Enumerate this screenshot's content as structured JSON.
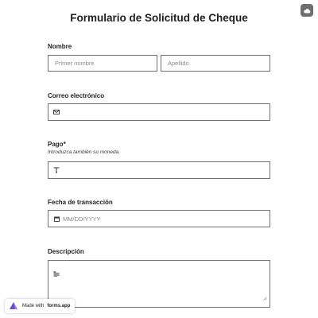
{
  "form": {
    "title": "Formulario de Solicitud de Cheque"
  },
  "fields": {
    "name": {
      "label": "Nombre",
      "first_placeholder": "Primer nombre",
      "last_placeholder": "Apellido"
    },
    "email": {
      "label": "Correo electrónico",
      "icon": "envelope-icon",
      "placeholder": ""
    },
    "payment": {
      "label": "Pago",
      "required_mark": "*",
      "hint": "Introduzca también su moneda.",
      "icon": "text-icon",
      "placeholder": ""
    },
    "date": {
      "label": "Fecha de transacción",
      "icon": "calendar-icon",
      "placeholder": "MM/DD/YYYY"
    },
    "description": {
      "label": "Descripción",
      "icon": "paragraph-icon"
    }
  },
  "badge": {
    "prefix": "Made with",
    "brand": "forms.app"
  },
  "colors": {
    "border": "#6f6f6f",
    "brand": "#6b4dd6",
    "top_button": "#6e6e6e"
  }
}
